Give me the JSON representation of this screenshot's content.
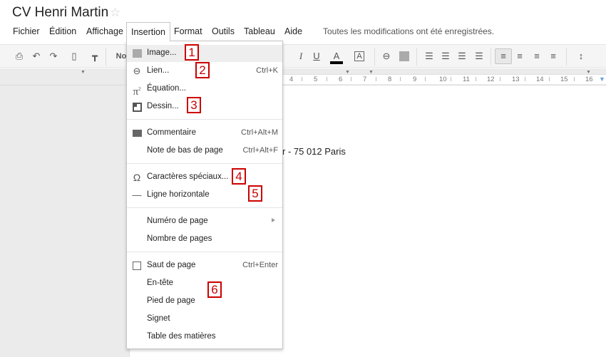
{
  "header": {
    "title": "CV Henri Martin",
    "star_icon": "star-outline-icon",
    "save_status": "Toutes les modifications ont été enregistrées."
  },
  "menubar": {
    "items": [
      {
        "label": "Fichier"
      },
      {
        "label": "Édition"
      },
      {
        "label": "Affichage"
      },
      {
        "label": "Insertion",
        "active": true
      },
      {
        "label": "Format"
      },
      {
        "label": "Outils"
      },
      {
        "label": "Tableau"
      },
      {
        "label": "Aide"
      }
    ]
  },
  "toolbar": {
    "style_partial": "No",
    "icons": [
      "print-icon",
      "undo-icon",
      "redo-icon",
      "paint-format-icon",
      "paint-roller-icon",
      "italic-icon",
      "underline-icon",
      "text-color-icon",
      "highlight-color-icon",
      "link-icon",
      "image-icon",
      "numbered-list-icon",
      "bulleted-list-icon",
      "decrease-indent-icon",
      "increase-indent-icon",
      "align-left-icon",
      "align-center-icon",
      "align-right-icon",
      "justify-icon",
      "line-spacing-icon"
    ],
    "text_color": "#000000"
  },
  "ruler": {
    "numbers": [
      "4",
      "5",
      "6",
      "7",
      "8",
      "9",
      "10",
      "11",
      "12",
      "13",
      "14",
      "15",
      "16"
    ]
  },
  "document": {
    "visible_text": "r -  75 012 Paris"
  },
  "insert_menu": {
    "items": [
      {
        "label": "Image...",
        "icon": "image-icon",
        "shortcut": "",
        "callout": "1"
      },
      {
        "label": "Lien...",
        "icon": "link-icon",
        "shortcut": "Ctrl+K",
        "callout": "2"
      },
      {
        "label": "Équation...",
        "icon": "pi-equation-icon",
        "shortcut": ""
      },
      {
        "label": "Dessin...",
        "icon": "drawing-icon",
        "shortcut": "",
        "callout": "3"
      },
      {
        "label": "Commentaire",
        "icon": "comment-icon",
        "shortcut": "Ctrl+Alt+M"
      },
      {
        "label": "Note de bas de page",
        "icon": "",
        "shortcut": "Ctrl+Alt+F"
      },
      {
        "label": "Caractères spéciaux...",
        "icon": "omega-icon",
        "shortcut": "",
        "callout": "4"
      },
      {
        "label": "Ligne horizontale",
        "icon": "horizontal-line-icon",
        "shortcut": "",
        "callout": "5"
      },
      {
        "label": "Numéro de page",
        "icon": "",
        "shortcut": "",
        "submenu": true
      },
      {
        "label": "Nombre de pages",
        "icon": "",
        "shortcut": ""
      },
      {
        "label": "Saut de page",
        "icon": "page-break-icon",
        "shortcut": "Ctrl+Enter"
      },
      {
        "label": "En-tête",
        "icon": "",
        "shortcut": ""
      },
      {
        "label": "Pied de page",
        "icon": "",
        "shortcut": "",
        "callout": "6"
      },
      {
        "label": "Signet",
        "icon": "",
        "shortcut": ""
      },
      {
        "label": "Table des matières",
        "icon": "",
        "shortcut": ""
      }
    ],
    "callout_color": "#cc0000"
  }
}
